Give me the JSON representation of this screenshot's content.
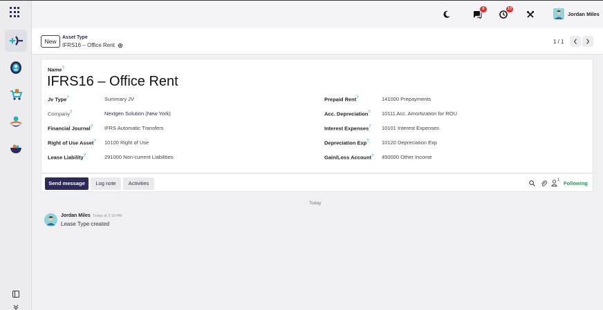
{
  "header": {
    "user_name": "Jordan Miles",
    "messages_count": "6",
    "activities_count": "10"
  },
  "control": {
    "new_label": "New",
    "breadcrumb_parent": "Asset Type",
    "breadcrumb_current": "IFRS16 – Office Rent",
    "pager": "1 / 1"
  },
  "form": {
    "name_label": "Name",
    "name_value": "IFRS16 – Office Rent",
    "left_fields": [
      {
        "label": "Jv Type",
        "value": "Summary JV"
      },
      {
        "label": "Company",
        "value": "Nextgen Solution (New York)"
      },
      {
        "label": "Financial Journal",
        "value": "IFRS Automatic Transfers"
      },
      {
        "label": "Right of Use Asset",
        "value": "10100 Right of Use"
      },
      {
        "label": "Lease Liability",
        "value": "291000 Non-current Liabilities"
      }
    ],
    "right_fields": [
      {
        "label": "Prepaid Rent",
        "value": "141000 Prepayments"
      },
      {
        "label": "Acc. Depreciation",
        "value": "10111 Acc. Amortization for ROU"
      },
      {
        "label": "Interest Expenses",
        "value": "10101 Interest Expenses"
      },
      {
        "label": "Depreciation Exp",
        "value": "10120 Depreciation Exp"
      },
      {
        "label": "Gain/Loss Account",
        "value": "450000 Other Income"
      }
    ]
  },
  "chatter": {
    "send_message": "Send message",
    "log_note": "Log note",
    "activities": "Activities",
    "followers_count": "1",
    "following": "Following",
    "date_separator": "Today",
    "message": {
      "author": "Jordan Miles",
      "time": "Today at 3:19 PM",
      "body": "Lease Type created"
    }
  },
  "colors": {
    "brand": "#2d2a5b",
    "following_green": "#18a058",
    "badge_red": "#e03131",
    "help_blue": "#1f9bd6"
  }
}
